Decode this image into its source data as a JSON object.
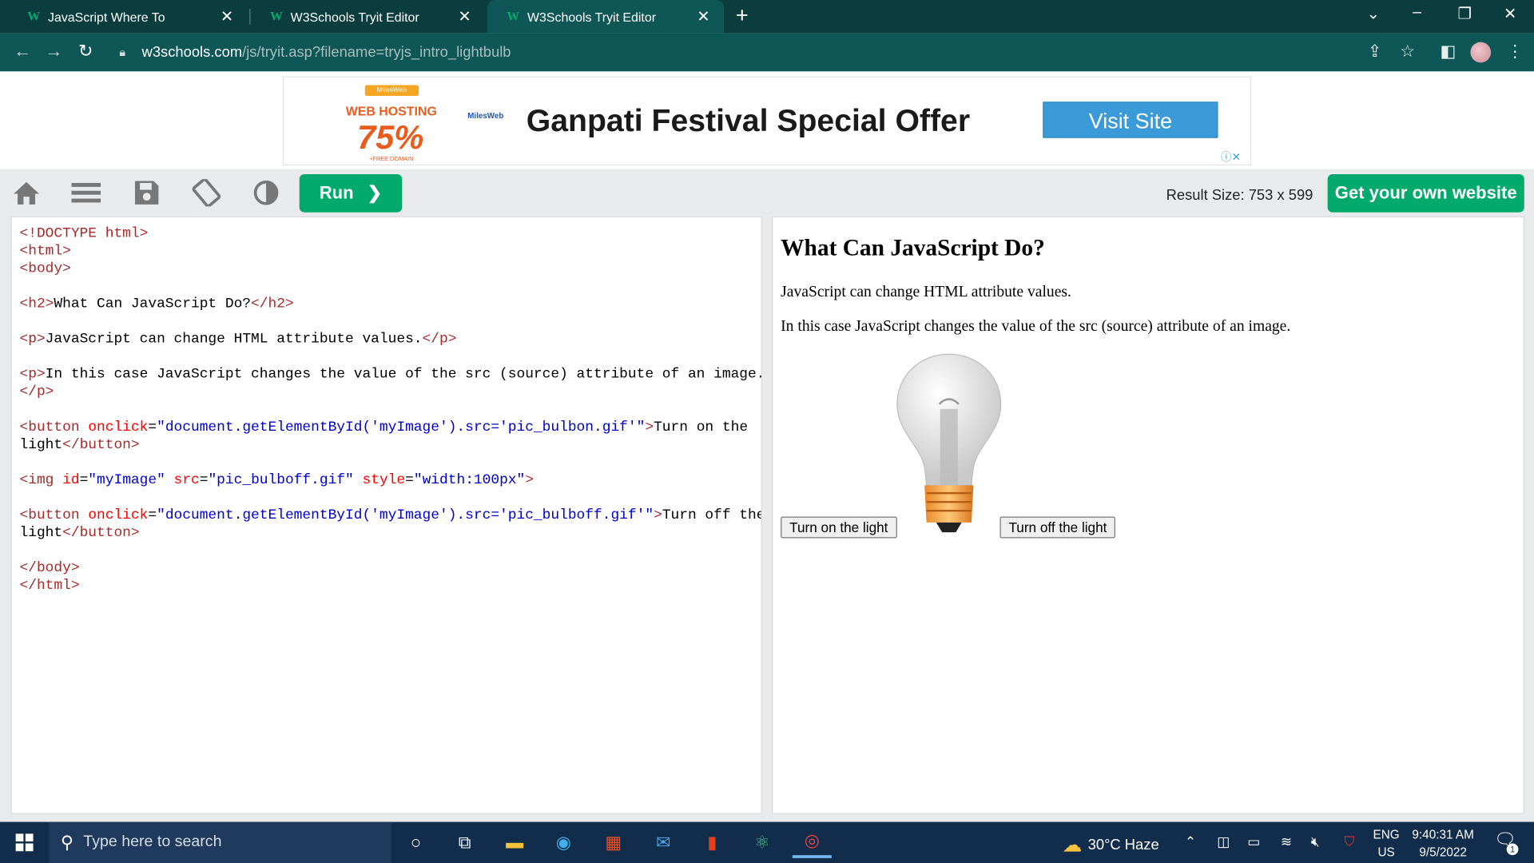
{
  "browser": {
    "tabs": [
      {
        "title": "JavaScript Where To",
        "favicon": "w3schools-icon"
      },
      {
        "title": "W3Schools Tryit Editor",
        "favicon": "w3schools-icon"
      },
      {
        "title": "W3Schools Tryit Editor",
        "favicon": "w3schools-icon",
        "active": true
      }
    ],
    "new_tab": "+",
    "url_host": "w3schools.com",
    "url_path": "/js/tryit.asp?filename=tryjs_intro_lightbulb",
    "accent": "#0f5656"
  },
  "ad": {
    "logo_brand": "MilesWeb",
    "logo_line1": "WEB HOSTING",
    "logo_percent": "75%",
    "logo_footer": "+FREE DOMAIN",
    "brand_small": "MilesWeb",
    "headline": "Ganpati Festival Special Offer",
    "cta": "Visit Site"
  },
  "tryit": {
    "run_label": "Run",
    "result_size": "Result Size: 753 x 599",
    "get_website": "Get your own website",
    "brand_color": "#04aa6d"
  },
  "code": {
    "l1": "<!DOCTYPE html>",
    "l2_tag": "<html>",
    "l3_tag": "<body>",
    "l4_open": "<h2>",
    "l4_text": "What Can JavaScript Do?",
    "l4_close": "</h2>",
    "l5_open": "<p>",
    "l5_text": "JavaScript can change HTML attribute values.",
    "l5_close": "</p>",
    "l6_open": "<p>",
    "l6_text": "In this case JavaScript changes the value of the src (source) attribute of an image.",
    "l6_close": "</p>",
    "l7_open": "<button",
    "l7_attr": " onclick",
    "l7_eq": "=",
    "l7_val": "\"document.getElementById('myImage').src='pic_bulbon.gif'\"",
    "l7_gt": ">",
    "l7_text_a": "Turn on the",
    "l7_text_b": "light",
    "l7_close": "</button>",
    "l8_open": "<img",
    "l8_a1": " id",
    "l8_v1": "\"myImage\"",
    "l8_a2": " src",
    "l8_v2": "\"pic_bulboff.gif\"",
    "l8_a3": " style",
    "l8_v3": "\"width:100px\"",
    "l8_gt": ">",
    "l9_open": "<button",
    "l9_attr": " onclick",
    "l9_val": "\"document.getElementById('myImage').src='pic_bulboff.gif'\"",
    "l9_gt": ">",
    "l9_text_a": "Turn off the",
    "l9_text_b": "light",
    "l9_close": "</button>",
    "l10": "</body>",
    "l11": "</html>"
  },
  "result": {
    "heading": "What Can JavaScript Do?",
    "p1": "JavaScript can change HTML attribute values.",
    "p2": "In this case JavaScript changes the value of the src (source) attribute of an image.",
    "btn_on": "Turn on the light",
    "btn_off": "Turn off the light"
  },
  "taskbar": {
    "search_placeholder": "Type here to search",
    "weather": "30°C  Haze",
    "lang_top": "ENG",
    "lang_bottom": "US",
    "time": "9:40:31 AM",
    "date": "9/5/2022",
    "notification_count": "1"
  }
}
